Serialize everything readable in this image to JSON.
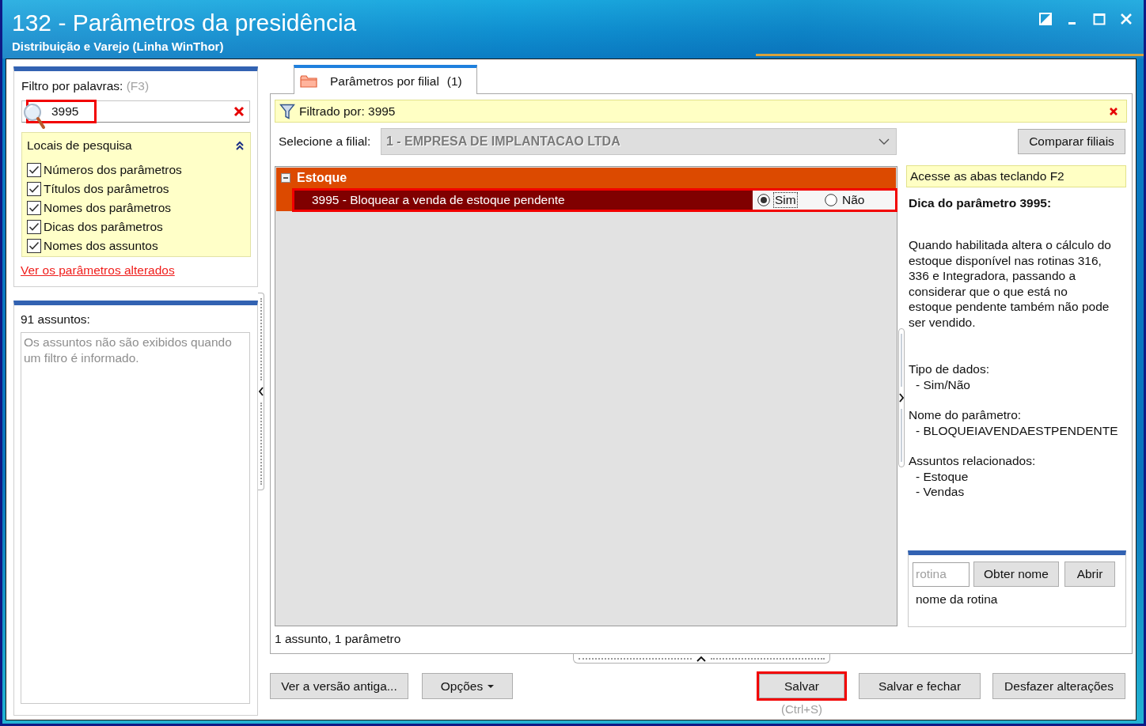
{
  "window": {
    "title": "132 - Parâmetros da presidência",
    "subtitle": "Distribuição e Varejo (Linha WinThor)"
  },
  "filter_panel": {
    "label": "Filtro por palavras:",
    "shortcut": "(F3)",
    "search": {
      "value": "3995",
      "highlighted": true
    },
    "search_places": {
      "title": "Locais de pesquisa",
      "expanded": true,
      "options": [
        {
          "label": "Números dos parâmetros",
          "checked": true
        },
        {
          "label": "Títulos dos parâmetros",
          "checked": true
        },
        {
          "label": "Nomes dos parâmetros",
          "checked": true
        },
        {
          "label": "Dicas dos parâmetros",
          "checked": true
        },
        {
          "label": "Nomes dos assuntos",
          "checked": true
        }
      ]
    },
    "link": "Ver os parâmetros alterados"
  },
  "subjects_panel": {
    "title": "91 assuntos:",
    "empty_message": [
      "Os assuntos não são exibidos quando",
      "um filtro é informado."
    ]
  },
  "tabs": [
    {
      "label": "Parâmetros por filial",
      "count": "(1)",
      "selected": true
    }
  ],
  "filter_bar": {
    "text": "Filtrado por: 3995"
  },
  "branch_select": {
    "label": "Selecione a filial:",
    "value": "1 - EMPRESA DE IMPLANTACAO LTDA",
    "disabled": true
  },
  "compare_button": "Comparar filiais",
  "groups": [
    {
      "name": "Estoque",
      "expanded": true,
      "parameters": [
        {
          "label": "3995 - Bloquear a venda de estoque pendente",
          "selected": true,
          "highlighted": true,
          "options": [
            {
              "label": "Sim",
              "selected": true,
              "focused": true
            },
            {
              "label": "Não",
              "selected": false,
              "focused": false
            }
          ]
        }
      ]
    }
  ],
  "status": "1 assunto, 1 parâmetro",
  "tip_panel": {
    "hint": "Acesse as abas teclando F2",
    "title": "Dica do parâmetro 3995:",
    "description": [
      "Quando habilitada altera o cálculo do",
      "estoque disponível nas rotinas 316,",
      "336 e Integradora, passando a",
      "considerar que o que está no",
      "estoque pendente também não pode",
      "ser vendido."
    ],
    "sections": [
      {
        "heading": "Tipo de dados:",
        "items": [
          "- Sim/Não"
        ]
      },
      {
        "heading": "Nome do parâmetro:",
        "items": [
          "- BLOQUEIAVENDAESTPENDENTE"
        ]
      },
      {
        "heading": "Assuntos relacionados:",
        "items": [
          "- Estoque",
          "- Vendas"
        ]
      }
    ]
  },
  "routine_lookup": {
    "placeholder": "rotina",
    "buttons": [
      "Obter nome",
      "Abrir"
    ],
    "result": "nome da rotina"
  },
  "footer": {
    "left_buttons": [
      {
        "label": "Ver a versão antiga...",
        "dropdown": false,
        "highlighted": false
      },
      {
        "label": "Opções",
        "dropdown": true,
        "highlighted": false
      }
    ],
    "right_buttons": [
      {
        "label": "Salvar",
        "dropdown": false,
        "highlighted": true,
        "shortcut": "(Ctrl+S)"
      },
      {
        "label": "Salvar e fechar",
        "dropdown": false,
        "highlighted": false
      },
      {
        "label": "Desfazer alterações",
        "dropdown": false,
        "highlighted": false
      }
    ]
  }
}
